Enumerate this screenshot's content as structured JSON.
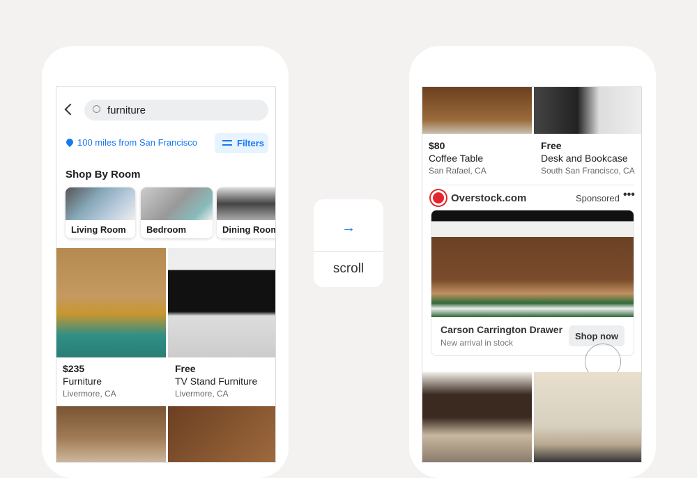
{
  "left": {
    "search": {
      "value": "furniture"
    },
    "location": "100 miles from San Francisco",
    "filters_label": "Filters",
    "section_title": "Shop By Room",
    "rooms": [
      {
        "label": "Living Room"
      },
      {
        "label": "Bedroom"
      },
      {
        "label": "Dining Room"
      }
    ],
    "listings": [
      {
        "price": "$235",
        "title": "Furniture",
        "location": "Livermore, CA"
      },
      {
        "price": "Free",
        "title": "TV Stand Furniture",
        "location": "Livermore, CA"
      }
    ]
  },
  "middle": {
    "icon": "arrow-right-icon",
    "label": "scroll"
  },
  "right": {
    "listings": [
      {
        "price": "$80",
        "title": "Coffee Table",
        "location": "San Rafael, CA"
      },
      {
        "price": "Free",
        "title": "Desk and Bookcase",
        "location": "South San Francisco, CA"
      }
    ],
    "ad": {
      "advertiser": "Overstock.com",
      "sponsored": "Sponsored",
      "title": "Carson Carrington Drawer",
      "subtitle": "New arrival in stock",
      "cta": "Shop now"
    }
  },
  "colors": {
    "accent": "#1877f2",
    "filters_bg": "#e7f3ff",
    "overstock_red": "#e4252c"
  }
}
